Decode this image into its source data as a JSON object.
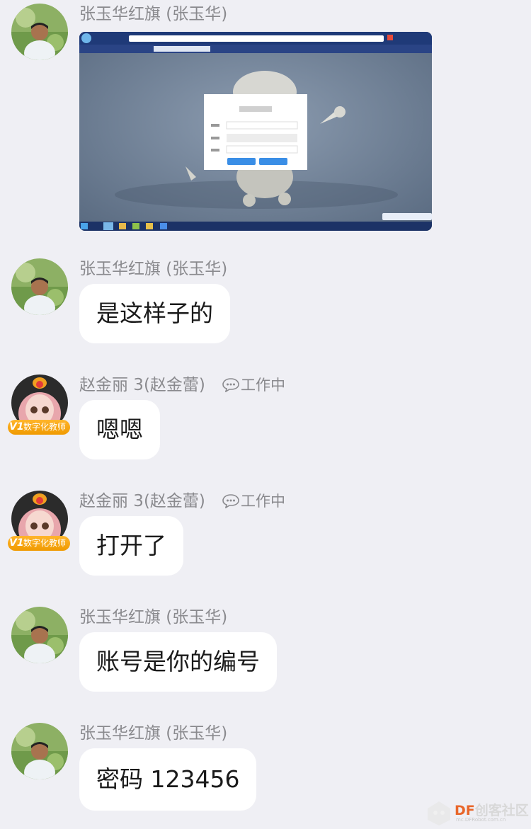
{
  "messages": [
    {
      "sender": "张玉华红旗 (张玉华)",
      "type": "image"
    },
    {
      "sender": "张玉华红旗 (张玉华)",
      "text": "是这样子的"
    },
    {
      "sender": "赵金丽 3(赵金蕾)",
      "status": "工作中",
      "badge": "数字化教师",
      "badge_level": "V1",
      "text": "嗯嗯"
    },
    {
      "sender": "赵金丽 3(赵金蕾)",
      "status": "工作中",
      "badge": "数字化教师",
      "badge_level": "V1",
      "text": "打开了"
    },
    {
      "sender": "张玉华红旗 (张玉华)",
      "text": "账号是你的编号"
    },
    {
      "sender": "张玉华红旗 (张玉华)",
      "text": "密码 123456"
    }
  ],
  "watermark": {
    "brand": "DF",
    "name": "创客社区",
    "url": "mc.DFRobot.com.cn"
  },
  "colors": {
    "background": "#efeff4",
    "bubble": "#ffffff",
    "name": "#8a8a8e",
    "badge": "#f5a623",
    "login_button": "#3a8ee6"
  }
}
